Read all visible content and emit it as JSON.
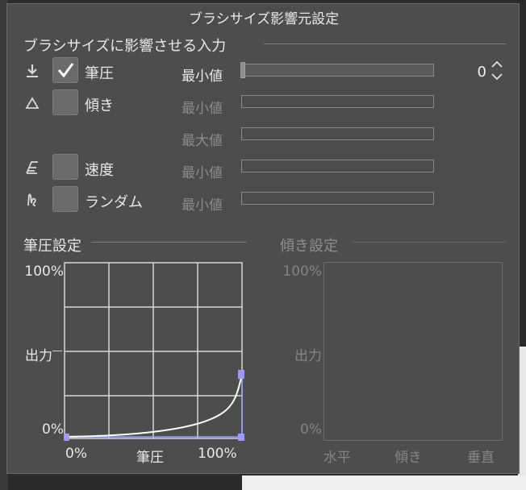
{
  "dialog": {
    "title": "ブラシサイズ影響元設定"
  },
  "influence": {
    "section_title": "ブラシサイズに影響させる入力",
    "rows": [
      {
        "label": "筆圧",
        "checked": true,
        "icon": "pen-pressure-icon"
      },
      {
        "label": "傾き",
        "checked": false,
        "icon": "tilt-icon"
      },
      {
        "label": "速度",
        "checked": false,
        "icon": "speed-icon"
      },
      {
        "label": "ランダム",
        "checked": false,
        "icon": "random-icon"
      }
    ],
    "params": [
      {
        "label": "最小値",
        "enabled": true,
        "value": "0",
        "fraction": 0
      },
      {
        "label": "最小値",
        "enabled": false
      },
      {
        "label": "最大値",
        "enabled": false
      },
      {
        "label": "最小値",
        "enabled": false
      },
      {
        "label": "最小値",
        "enabled": false
      }
    ]
  },
  "pressure_settings": {
    "section_title": "筆圧設定",
    "y_top": "100%",
    "y_mid": "出力",
    "y_bottom": "0%",
    "x_left": "0%",
    "x_mid": "筆圧",
    "x_right": "100%",
    "curve_color": "#ffffff",
    "handle_color": "#9b9bff"
  },
  "tilt_settings": {
    "section_title": "傾き設定",
    "y_top": "100%",
    "y_mid": "出力",
    "y_bottom": "0%",
    "x_left": "水平",
    "x_mid": "傾き",
    "x_right": "垂直"
  }
}
